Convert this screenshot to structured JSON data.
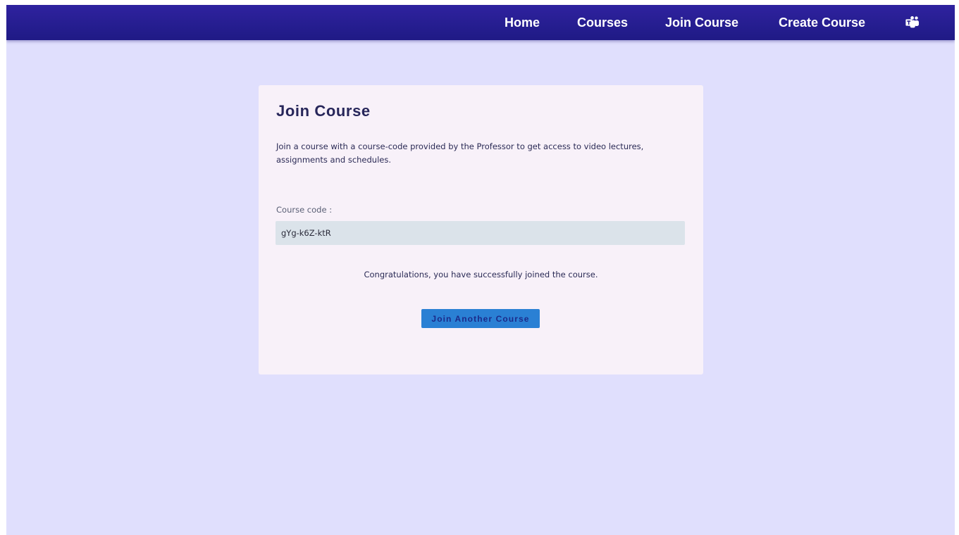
{
  "nav": {
    "home": "Home",
    "courses": "Courses",
    "join_course": "Join Course",
    "create_course": "Create Course",
    "teams_icon": "microsoft-teams-icon"
  },
  "card": {
    "title": "Join Course",
    "description": "Join a course with a course-code provided by the Professor to get access to video lectures, assignments and schedules.",
    "field_label": "Course code :",
    "course_code_value": "gYg-k6Z-ktR",
    "success_message": "Congratulations, you have successfully joined the course.",
    "button_label": "Join Another Course"
  },
  "colors": {
    "navbar": "#2a1f96",
    "page_background": "#e0dffd",
    "card_background": "#f8f1f9",
    "input_background": "#dbe3ea",
    "button_background": "#2a80d4",
    "button_text": "#1b2a8a",
    "heading_text": "#27265a"
  }
}
